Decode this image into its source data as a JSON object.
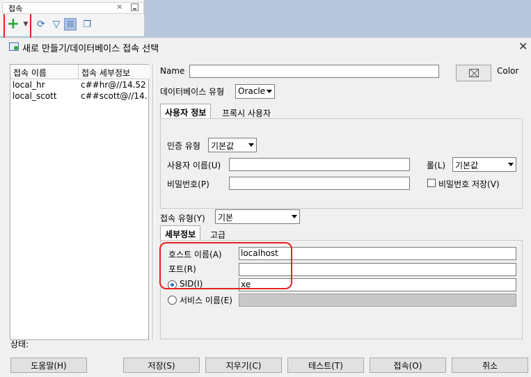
{
  "connections_panel": {
    "tab_label": "접속",
    "close_glyph": "×"
  },
  "toolbar": {
    "icons": [
      "add-icon",
      "chevron-down-icon",
      "refresh-icon",
      "filter-icon",
      "schema-icon",
      "window-icon"
    ]
  },
  "dialog": {
    "title": "새로 만들기/데이터베이스 접속 선택",
    "close_glyph": "✕"
  },
  "connection_list": {
    "headers": [
      "접속 이름",
      "접속 세부정보"
    ],
    "rows": [
      {
        "name": "local_hr",
        "detail": "c##hr@//14.52..."
      },
      {
        "name": "local_scott",
        "detail": "c##scott@//14..."
      }
    ]
  },
  "form": {
    "name_label": "Name",
    "name_value": "",
    "color_label": "Color",
    "dbtype_label": "데이터베이스 유형",
    "dbtype_value": "Oracle",
    "tabs": [
      "사용자 정보",
      "프록시 사용자"
    ],
    "auth_label": "인증 유형",
    "auth_value": "기본값",
    "username_label": "사용자 이름(U)",
    "username_value": "",
    "role_label": "롤(L)",
    "role_value": "기본값",
    "password_label": "비밀번호(P)",
    "save_password_label": "비밀번호 저장(V)",
    "conntype_label": "접속 유형(Y)",
    "conntype_value": "기본",
    "detail_tabs": [
      "세부정보",
      "고급"
    ],
    "host_label": "호스트 이름(A)",
    "host_value": "localhost",
    "port_label": "포트(R)",
    "port_value": "",
    "sid_label": "SID(I)",
    "sid_value": "xe",
    "service_label": "서비스 이름(E)"
  },
  "status_label": "상태:",
  "buttons": {
    "help": "도움말(H)",
    "save": "저장(S)",
    "clear": "지우기(C)",
    "test": "테스트(T)",
    "connect": "접속(O)",
    "cancel": "취소"
  },
  "annotation_color": "#e52020"
}
